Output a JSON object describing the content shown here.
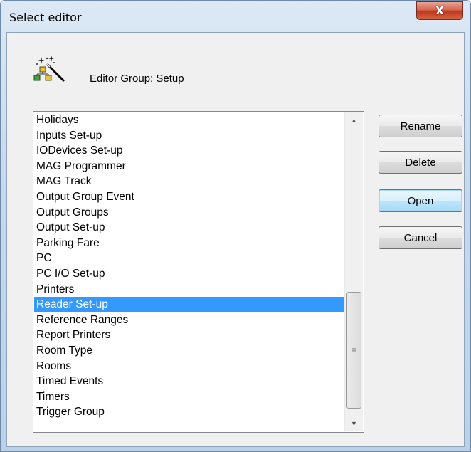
{
  "window": {
    "title": "Select editor",
    "close_label": "X"
  },
  "header": {
    "group_label": "Editor Group: Setup",
    "icon": "magic-wand-hierarchy-icon"
  },
  "editor_list": {
    "items": [
      "Holidays",
      "Inputs Set-up",
      "IODevices Set-up",
      "MAG Programmer",
      "MAG Track",
      "Output Group Event",
      "Output Groups",
      "Output Set-up",
      "Parking Fare",
      "PC",
      "PC I/O Set-up",
      "Printers",
      "Reader Set-up",
      "Reference Ranges",
      "Report Printers",
      "Room Type",
      "Rooms",
      "Timed Events",
      "Timers",
      "Trigger Group"
    ],
    "selected": "Reader Set-up"
  },
  "buttons": {
    "rename": "Rename",
    "delete": "Delete",
    "open": "Open",
    "cancel": "Cancel"
  },
  "colors": {
    "selection": "#3399ff",
    "close_button": "#c7412a"
  }
}
